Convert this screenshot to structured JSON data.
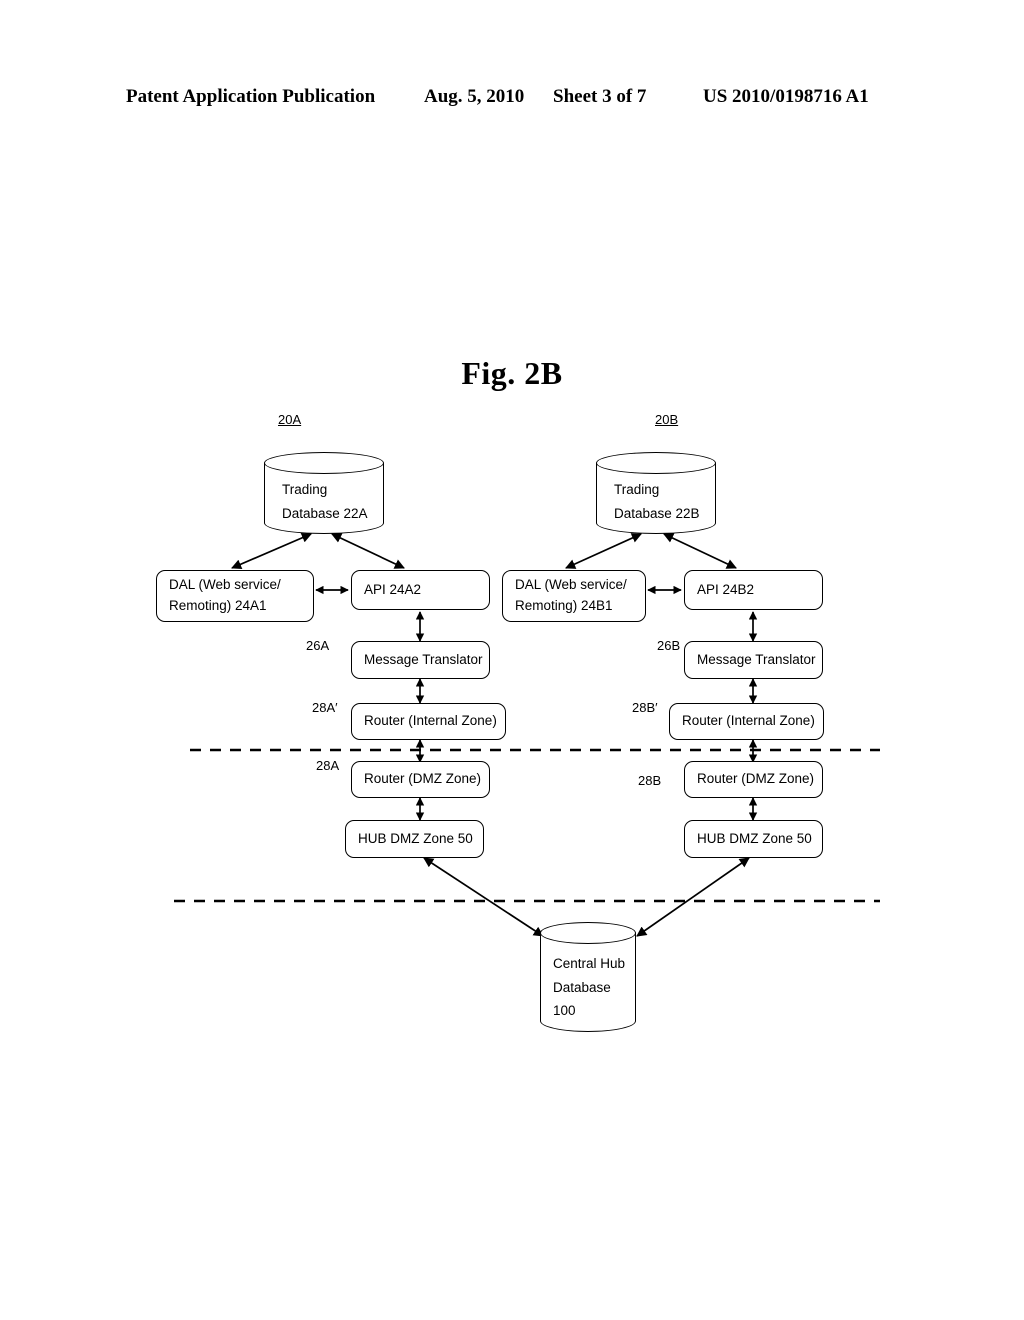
{
  "header": {
    "publication": "Patent Application Publication",
    "date": "Aug. 5, 2010",
    "sheet": "Sheet 3 of 7",
    "number": "US 2010/0198716 A1"
  },
  "figure": {
    "title": "Fig. 2B"
  },
  "diagram": {
    "type": "block-diagram",
    "group_labels": {
      "left": "20A",
      "right": "20B"
    },
    "side_refs": {
      "left_translator": "26A",
      "left_router_internal": "28A′",
      "left_router_dmz": "28A",
      "right_translator": "26B",
      "right_router_internal": "28B′",
      "right_router_dmz": "28B"
    },
    "nodes": {
      "trading_db_a": {
        "line1": "Trading",
        "line2": "Database 22A"
      },
      "trading_db_b": {
        "line1": "Trading",
        "line2": "Database 22B"
      },
      "dal_a": {
        "line1": "DAL (Web service/",
        "line2": "Remoting) 24A1"
      },
      "dal_b": {
        "line1": "DAL (Web service/",
        "line2": "Remoting) 24B1"
      },
      "api_a": {
        "label": "API 24A2"
      },
      "api_b": {
        "label": "API 24B2"
      },
      "translator_a": {
        "label": "Message Translator"
      },
      "translator_b": {
        "label": "Message Translator"
      },
      "router_internal_a": {
        "label": "Router (Internal Zone)"
      },
      "router_internal_b": {
        "label": "Router (Internal Zone)"
      },
      "router_dmz_a": {
        "label": "Router (DMZ Zone)"
      },
      "router_dmz_b": {
        "label": "Router (DMZ Zone)"
      },
      "hub_dmz_a": {
        "label": "HUB DMZ Zone 50"
      },
      "hub_dmz_b": {
        "label": "HUB DMZ Zone 50"
      },
      "central_hub_db": {
        "line1": "Central Hub",
        "line2": "Database",
        "line3": "100"
      }
    },
    "colors": {
      "stroke": "#000000",
      "background": "#ffffff"
    }
  }
}
